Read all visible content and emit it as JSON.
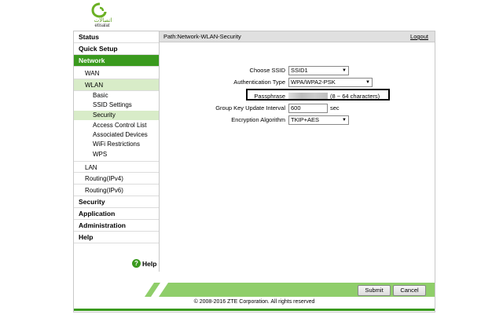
{
  "brand": {
    "name_latin": "etisalat",
    "name_arabic": "اتصالات",
    "color": "#6ab023"
  },
  "sidebar": {
    "items": [
      {
        "label": "Status"
      },
      {
        "label": "Quick Setup"
      },
      {
        "label": "Network"
      },
      {
        "label": "WAN"
      },
      {
        "label": "WLAN"
      },
      {
        "label": "Basic"
      },
      {
        "label": "SSID Settings"
      },
      {
        "label": "Security"
      },
      {
        "label": "Access Control List"
      },
      {
        "label": "Associated Devices"
      },
      {
        "label": "WiFi Restrictions"
      },
      {
        "label": "WPS"
      },
      {
        "label": "LAN"
      },
      {
        "label": "Routing(IPv4)"
      },
      {
        "label": "Routing(IPv6)"
      },
      {
        "label": "Security"
      },
      {
        "label": "Application"
      },
      {
        "label": "Administration"
      },
      {
        "label": "Help"
      }
    ],
    "help_label": "Help",
    "help_icon": "?"
  },
  "topbar": {
    "path": "Path:Network-WLAN-Security",
    "logout": "Logout"
  },
  "form": {
    "ssid_label": "Choose SSID",
    "ssid_value": "SSID1",
    "auth_label": "Authentication Type",
    "auth_value": "WPA/WPA2-PSK",
    "pass_label": "Passphrase",
    "pass_hint": "(8 ~ 64 characters)",
    "gk_label": "Group Key Update Interval",
    "gk_value": "600",
    "gk_unit": "sec",
    "enc_label": "Encryption Algorithm",
    "enc_value": "TKIP+AES"
  },
  "buttons": {
    "submit": "Submit",
    "cancel": "Cancel"
  },
  "footer": {
    "copyright": "© 2008-2016 ZTE Corporation. All rights reserved"
  },
  "colors": {
    "accent": "#3a9a1e",
    "sub_active": "#d8ecc8",
    "stripe": "#8fce6a"
  }
}
